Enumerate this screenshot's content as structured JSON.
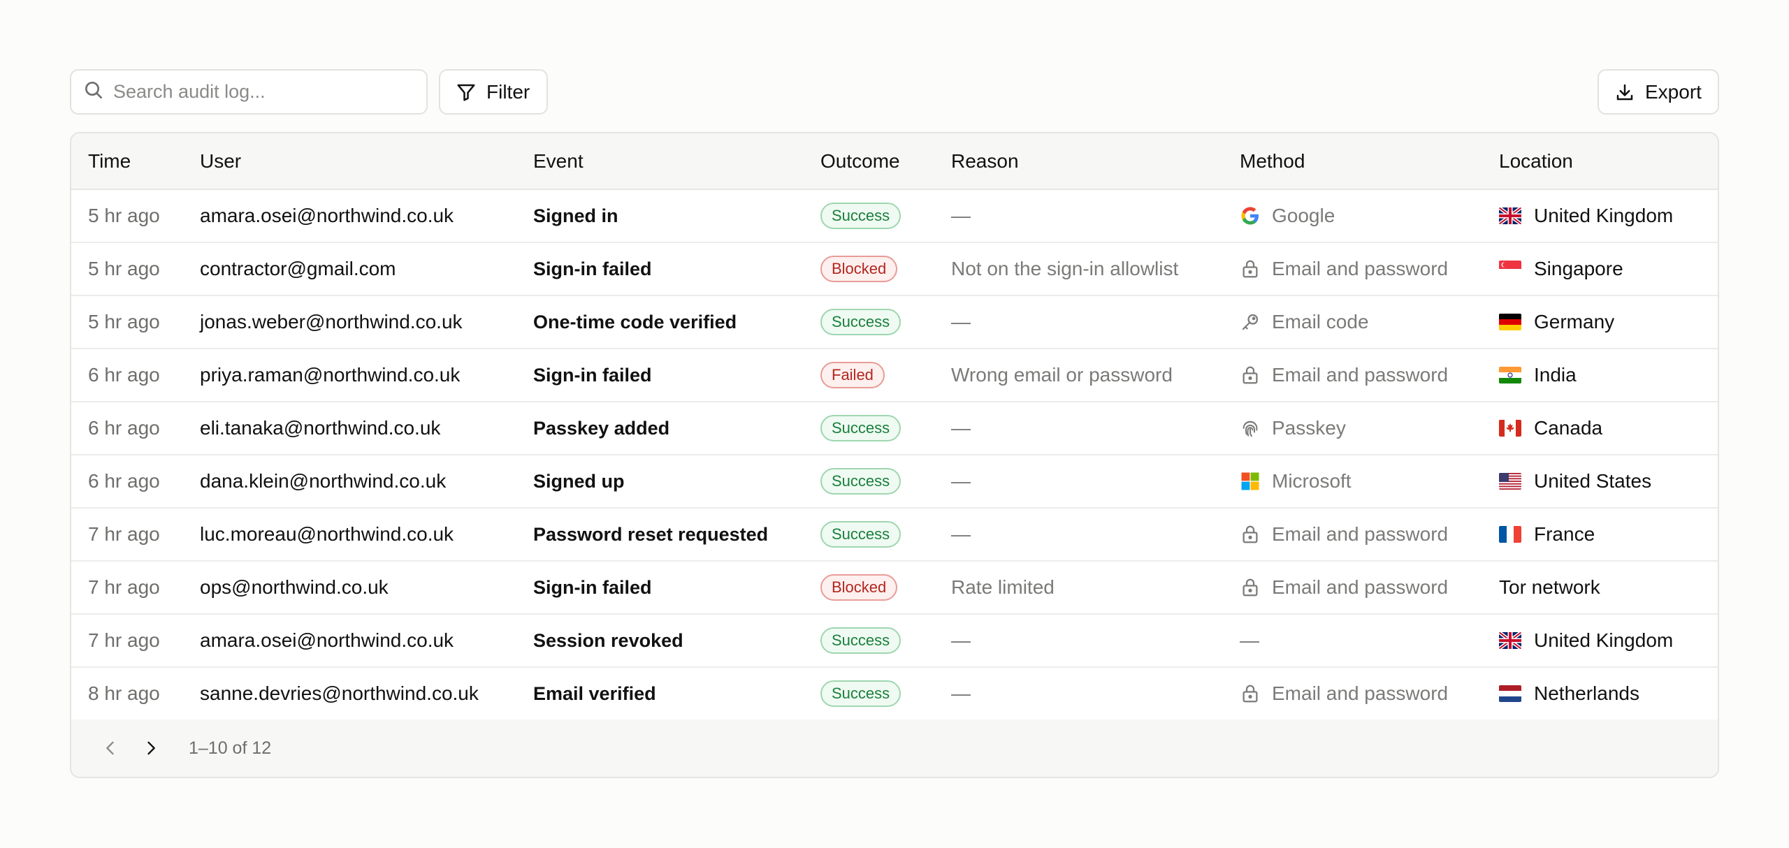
{
  "toolbar": {
    "search_placeholder": "Search audit log...",
    "filter_label": "Filter",
    "export_label": "Export"
  },
  "table": {
    "columns": [
      "Time",
      "User",
      "Event",
      "Outcome",
      "Reason",
      "Method",
      "Location"
    ],
    "rows": [
      {
        "time": "5 hr ago",
        "user": "amara.osei@northwind.co.uk",
        "event": "Signed in",
        "outcome": "Success",
        "outcome_type": "success",
        "reason": "—",
        "method": "Google",
        "method_icon": "google-icon",
        "location": "United Kingdom",
        "flag": "gb"
      },
      {
        "time": "5 hr ago",
        "user": "contractor@gmail.com",
        "event": "Sign-in failed",
        "outcome": "Blocked",
        "outcome_type": "blocked",
        "reason": "Not on the sign-in allowlist",
        "method": "Email and password",
        "method_icon": "lock-icon",
        "location": "Singapore",
        "flag": "sg"
      },
      {
        "time": "5 hr ago",
        "user": "jonas.weber@northwind.co.uk",
        "event": "One-time code verified",
        "outcome": "Success",
        "outcome_type": "success",
        "reason": "—",
        "method": "Email code",
        "method_icon": "key-icon",
        "location": "Germany",
        "flag": "de"
      },
      {
        "time": "6 hr ago",
        "user": "priya.raman@northwind.co.uk",
        "event": "Sign-in failed",
        "outcome": "Failed",
        "outcome_type": "failed",
        "reason": "Wrong email or password",
        "method": "Email and password",
        "method_icon": "lock-icon",
        "location": "India",
        "flag": "in"
      },
      {
        "time": "6 hr ago",
        "user": "eli.tanaka@northwind.co.uk",
        "event": "Passkey added",
        "outcome": "Success",
        "outcome_type": "success",
        "reason": "—",
        "method": "Passkey",
        "method_icon": "fingerprint-icon",
        "location": "Canada",
        "flag": "ca"
      },
      {
        "time": "6 hr ago",
        "user": "dana.klein@northwind.co.uk",
        "event": "Signed up",
        "outcome": "Success",
        "outcome_type": "success",
        "reason": "—",
        "method": "Microsoft",
        "method_icon": "microsoft-icon",
        "location": "United States",
        "flag": "us"
      },
      {
        "time": "7 hr ago",
        "user": "luc.moreau@northwind.co.uk",
        "event": "Password reset requested",
        "outcome": "Success",
        "outcome_type": "success",
        "reason": "—",
        "method": "Email and password",
        "method_icon": "lock-icon",
        "location": "France",
        "flag": "fr"
      },
      {
        "time": "7 hr ago",
        "user": "ops@northwind.co.uk",
        "event": "Sign-in failed",
        "outcome": "Blocked",
        "outcome_type": "blocked",
        "reason": "Rate limited",
        "method": "Email and password",
        "method_icon": "lock-icon",
        "location": "Tor network",
        "flag": ""
      },
      {
        "time": "7 hr ago",
        "user": "amara.osei@northwind.co.uk",
        "event": "Session revoked",
        "outcome": "Success",
        "outcome_type": "success",
        "reason": "—",
        "method": "—",
        "method_icon": "",
        "location": "United Kingdom",
        "flag": "gb"
      },
      {
        "time": "8 hr ago",
        "user": "sanne.devries@northwind.co.uk",
        "event": "Email verified",
        "outcome": "Success",
        "outcome_type": "success",
        "reason": "—",
        "method": "Email and password",
        "method_icon": "lock-icon",
        "location": "Netherlands",
        "flag": "nl"
      }
    ]
  },
  "pagination": {
    "range_text": "1–10 of 12"
  },
  "colors": {
    "success": "#1a7f3c",
    "danger": "#b3261e",
    "muted": "#7a7a78"
  }
}
